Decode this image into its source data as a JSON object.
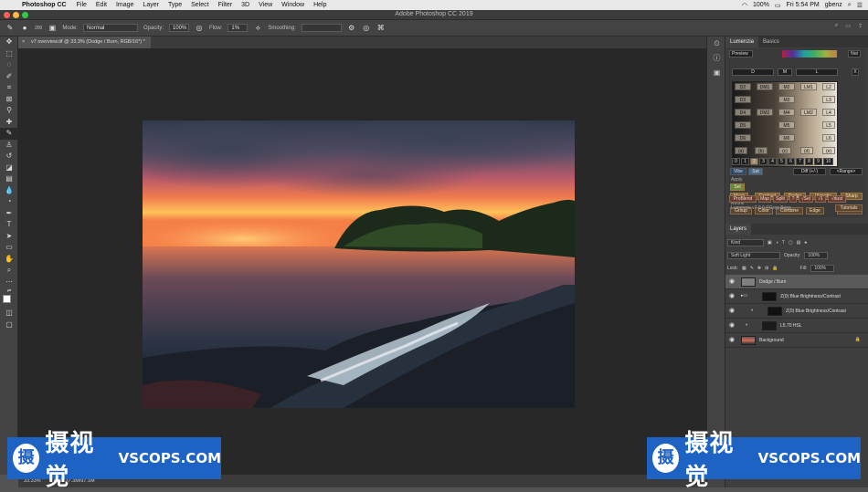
{
  "menubar": {
    "app_name": "Photoshop CC",
    "items": [
      "File",
      "Edit",
      "Image",
      "Layer",
      "Type",
      "Select",
      "Filter",
      "3D",
      "View",
      "Window",
      "Help"
    ],
    "battery": "100%",
    "clock": "Fri 5:54 PM",
    "user": "gbenz"
  },
  "window": {
    "title": "Adobe Photoshop CC 2019"
  },
  "options": {
    "mode_label": "Mode:",
    "mode_value": "Normal",
    "opacity_label": "Opacity:",
    "opacity_value": "100%",
    "flow_label": "Flow:",
    "flow_value": "1%",
    "smoothing_label": "Smoothing:",
    "brush_size": "200"
  },
  "document": {
    "tab_title": "v7 overview.tif @ 33.3% (Dodge / Burn, RGB/16*) *",
    "zoom": "33.33%",
    "doc_size": "Doc: 37.3M/97.1M"
  },
  "panel": {
    "tabs": [
      "Lumenzia",
      "Basics"
    ],
    "preview_label": "Preview",
    "not_label": "Not",
    "x_label": "X",
    "zone_buttons": [
      "D",
      "M",
      "L"
    ],
    "grid_rows": [
      [
        "D2",
        "DM1",
        "M2",
        "LM1",
        "L2"
      ],
      [
        "D3",
        "M3",
        "L3"
      ],
      [
        "D4",
        "DM2",
        "M4",
        "LM2",
        "L4"
      ],
      [
        "D5",
        "M5",
        "L5"
      ],
      [
        "D6",
        "M6",
        "L6"
      ]
    ],
    "letters": [
      "(a)",
      "(b)",
      "(c)",
      "(d)",
      "(e)"
    ],
    "numbers": [
      "0",
      "1",
      "2",
      "3",
      "4",
      "5",
      "6",
      "7",
      "8",
      "9",
      "10"
    ],
    "vibe": "Vibe",
    "sat": "Sat",
    "diff": "Diff (+/-)",
    "range": "<Range>",
    "apply_label": "Apply",
    "sel": "Sel",
    "apply_buttons": [
      "Mask",
      "Contrast",
      "Dodge",
      "Vignette",
      "Sharp"
    ],
    "refine_label": "Refine",
    "refine_buttons": [
      "Group",
      "Color",
      "Combine",
      "Edge",
      "Before"
    ],
    "bottom_buttons": [
      "ProBlend",
      "Map",
      "Split",
      "?",
      "√Sel",
      "√1",
      "√dust"
    ],
    "version": "Lumenzia v7.0.0 ©Greg Benz",
    "tutorials": "Tutorials"
  },
  "layers": {
    "title": "Layers",
    "kind": "Kind",
    "blend_mode": "Soft Light",
    "opacity_label": "Opacity:",
    "opacity_value": "100%",
    "lock_label": "Lock:",
    "fill_label": "Fill:",
    "fill_value": "100%",
    "rows": [
      "Dodge / Burn",
      "Z(0) Blue Brightness/Contrast",
      "Z(0) Blue Brightness/Contrast",
      "L5.70 HSL",
      "Background"
    ]
  },
  "watermark": {
    "cn": "摄视觉",
    "en": "VSCOPS.COM",
    "logo_char": "摄"
  },
  "colors": {
    "accent_orange": "#a37a44",
    "watermark_blue": "#1e62c4",
    "canvas_bg": "#282828"
  }
}
